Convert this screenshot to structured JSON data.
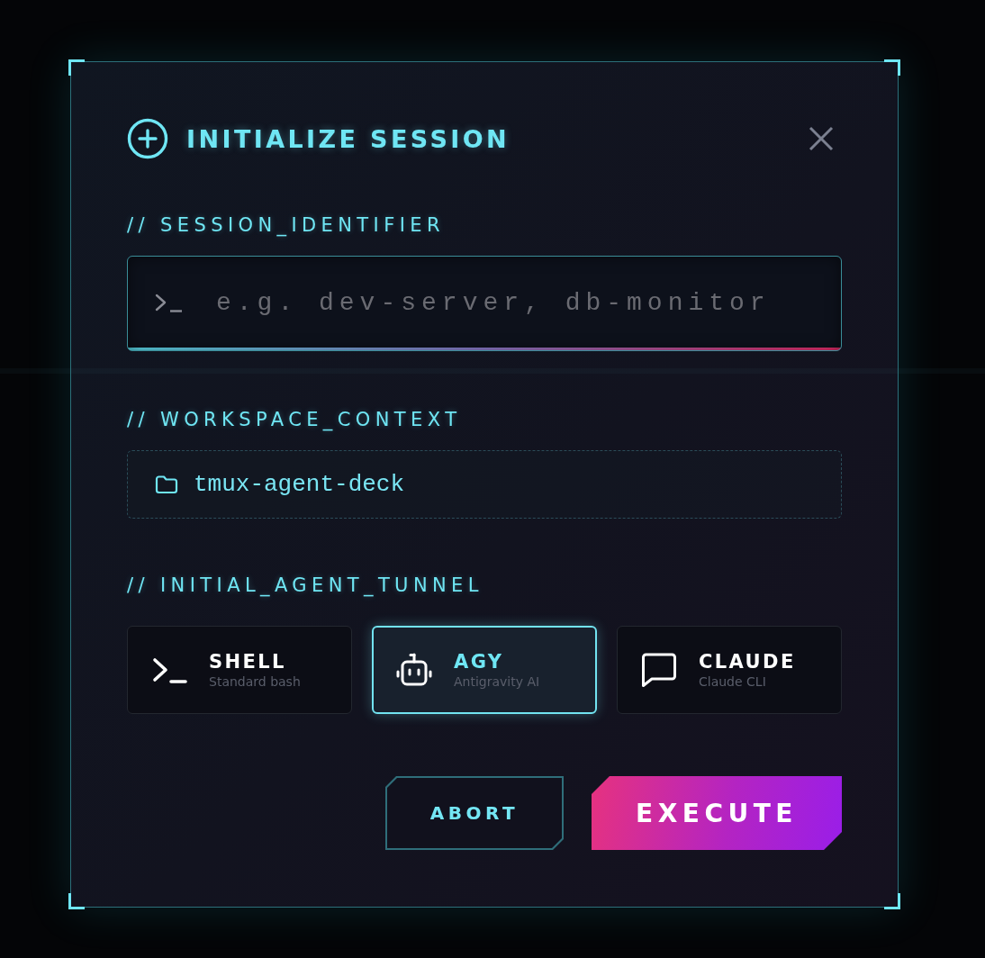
{
  "dialog": {
    "title": "INITIALIZE SESSION"
  },
  "fields": [
    {
      "kind": "text_input",
      "label": "// SESSION_IDENTIFIER",
      "placeholder": "e.g. dev-server, db-monitor"
    },
    {
      "kind": "path",
      "label": "// WORKSPACE_CONTEXT",
      "value": "tmux-agent-deck"
    },
    {
      "kind": "choice",
      "label": "// INITIAL_AGENT_TUNNEL",
      "options": [
        {
          "kind": "terminal",
          "title": "SHELL",
          "subtitle": "Standard bash",
          "selected": false
        },
        {
          "kind": "robot",
          "title": "AGY",
          "subtitle": "Antigravity AI",
          "selected": true
        },
        {
          "kind": "chat",
          "title": "CLAUDE",
          "subtitle": "Claude CLI",
          "selected": false
        }
      ]
    }
  ],
  "buttons": [
    {
      "kind": "secondary",
      "label": "ABORT"
    },
    {
      "kind": "primary",
      "label": "EXECUTE"
    }
  ]
}
